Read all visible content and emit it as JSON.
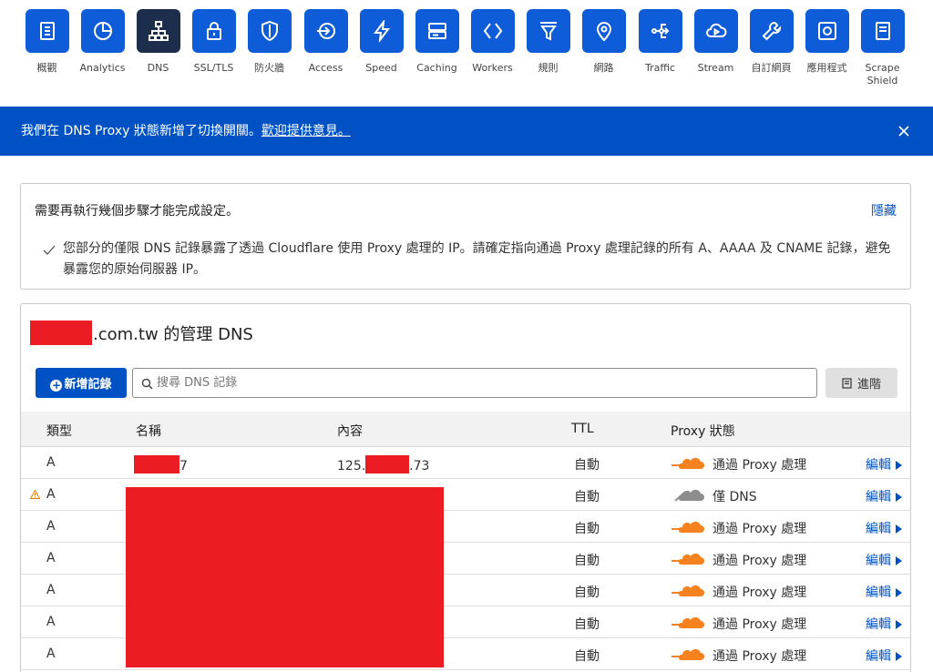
{
  "nav": {
    "items": [
      {
        "label": "概觀",
        "icon": "clipboard-icon"
      },
      {
        "label": "Analytics",
        "icon": "pie-chart-icon"
      },
      {
        "label": "DNS",
        "icon": "network-icon",
        "active": true
      },
      {
        "label": "SSL/TLS",
        "icon": "lock-icon"
      },
      {
        "label": "防火牆",
        "icon": "shield-icon"
      },
      {
        "label": "Access",
        "icon": "access-arrow-icon"
      },
      {
        "label": "Speed",
        "icon": "lightning-icon"
      },
      {
        "label": "Caching",
        "icon": "server-stack-icon"
      },
      {
        "label": "Workers",
        "icon": "workers-chevrons-icon"
      },
      {
        "label": "規則",
        "icon": "funnel-icon"
      },
      {
        "label": "網路",
        "icon": "location-pin-icon"
      },
      {
        "label": "Traffic",
        "icon": "traffic-share-icon"
      },
      {
        "label": "Stream",
        "icon": "cloud-play-icon"
      },
      {
        "label": "自訂網頁",
        "icon": "wrench-icon"
      },
      {
        "label": "應用程式",
        "icon": "app-box-icon"
      },
      {
        "label": "Scrape Shield",
        "icon": "document-icon"
      }
    ]
  },
  "banner": {
    "text": "我們在 DNS Proxy 狀態新增了切換開關。",
    "link": "歡迎提供意見。"
  },
  "setup": {
    "title": "需要再執行幾個步驟才能完成設定。",
    "hide": "隱藏",
    "message": "您部分的僅限 DNS 記錄暴露了透過 Cloudflare 使用 Proxy 處理的 IP。請確定指向通過 Proxy 處理記錄的所有 A、AAAA 及 CNAME 記錄，避免暴露您的原始伺服器 IP。"
  },
  "dns": {
    "title_suffix": ".com.tw 的管理 DNS",
    "add_button": "新增記錄",
    "search_placeholder": "搜尋 DNS 記錄",
    "advanced_button": "進階",
    "columns": {
      "type": "類型",
      "name": "名稱",
      "content": "內容",
      "ttl": "TTL",
      "proxy": "Proxy 狀態"
    },
    "rows": [
      {
        "type": "A",
        "name_suffix": "7",
        "content_prefix": "125.",
        "content_suffix": ".73",
        "ttl": "自動",
        "proxy": "通過 Proxy 處理",
        "proxied": true,
        "warning": false,
        "edit": "編輯"
      },
      {
        "type": "A",
        "ttl": "自動",
        "proxy": "僅 DNS",
        "proxied": false,
        "warning": true,
        "edit": "編輯"
      },
      {
        "type": "A",
        "ttl": "自動",
        "proxy": "通過 Proxy 處理",
        "proxied": true,
        "warning": false,
        "edit": "編輯"
      },
      {
        "type": "A",
        "ttl": "自動",
        "proxy": "通過 Proxy 處理",
        "proxied": true,
        "warning": false,
        "edit": "編輯"
      },
      {
        "type": "A",
        "ttl": "自動",
        "proxy": "通過 Proxy 處理",
        "proxied": true,
        "warning": false,
        "edit": "編輯"
      },
      {
        "type": "A",
        "ttl": "自動",
        "proxy": "通過 Proxy 處理",
        "proxied": true,
        "warning": false,
        "edit": "編輯"
      },
      {
        "type": "A",
        "ttl": "自動",
        "proxy": "通過 Proxy 處理",
        "proxied": true,
        "warning": false,
        "edit": "編輯"
      }
    ]
  },
  "colors": {
    "brand_blue": "#0051c3",
    "nav_blue": "#0f5cd9",
    "nav_active": "#1d2e4d",
    "proxy_orange": "#f6821f",
    "dns_only_gray": "#8d8d8d",
    "redaction": "#ec1c24"
  }
}
